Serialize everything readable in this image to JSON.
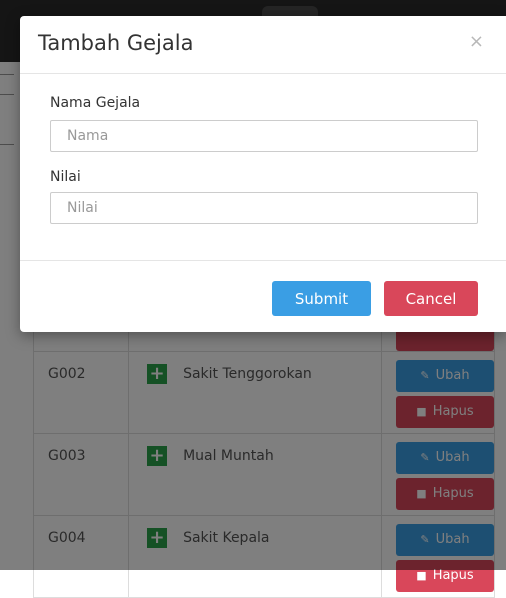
{
  "modal": {
    "title": "Tambah Gejala",
    "close_glyph": "×",
    "fields": [
      {
        "label": "Nama Gejala",
        "placeholder": "Nama",
        "value": ""
      },
      {
        "label": "Nilai",
        "placeholder": "Nilai",
        "value": ""
      }
    ],
    "submit_label": "Submit",
    "cancel_label": "Cancel"
  },
  "table": {
    "rows": [
      {
        "code": "G002",
        "name": "Sakit Tenggorokan",
        "edit_label": "Ubah",
        "delete_label": "Hapus"
      },
      {
        "code": "G003",
        "name": "Mual Muntah",
        "edit_label": "Ubah",
        "delete_label": "Hapus"
      },
      {
        "code": "G004",
        "name": "Sakit Kepala",
        "edit_label": "Ubah",
        "delete_label": "Hapus"
      }
    ]
  },
  "icons": {
    "row_add": "plus-square-icon",
    "edit": "edit-icon",
    "delete": "trash-icon",
    "close": "close-icon"
  },
  "colors": {
    "primary": "#3a9ee4",
    "danger": "#d9475a",
    "success": "#2aa34a"
  }
}
